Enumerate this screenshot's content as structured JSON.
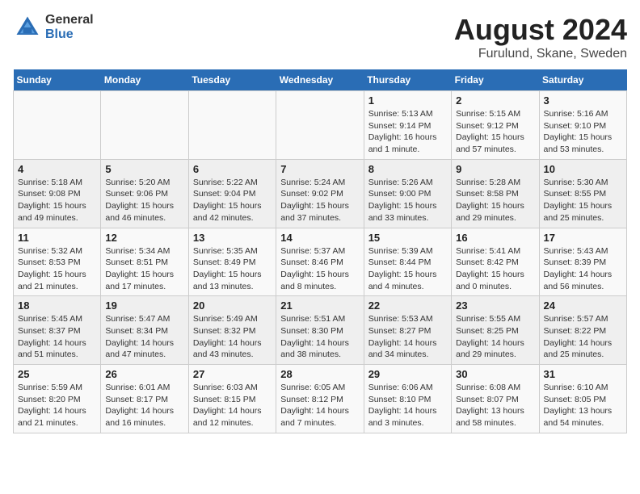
{
  "header": {
    "logo_general": "General",
    "logo_blue": "Blue",
    "main_title": "August 2024",
    "subtitle": "Furulund, Skane, Sweden"
  },
  "calendar": {
    "days_of_week": [
      "Sunday",
      "Monday",
      "Tuesday",
      "Wednesday",
      "Thursday",
      "Friday",
      "Saturday"
    ],
    "weeks": [
      [
        {
          "day": "",
          "info": ""
        },
        {
          "day": "",
          "info": ""
        },
        {
          "day": "",
          "info": ""
        },
        {
          "day": "",
          "info": ""
        },
        {
          "day": "1",
          "info": "Sunrise: 5:13 AM\nSunset: 9:14 PM\nDaylight: 16 hours and 1 minute."
        },
        {
          "day": "2",
          "info": "Sunrise: 5:15 AM\nSunset: 9:12 PM\nDaylight: 15 hours and 57 minutes."
        },
        {
          "day": "3",
          "info": "Sunrise: 5:16 AM\nSunset: 9:10 PM\nDaylight: 15 hours and 53 minutes."
        }
      ],
      [
        {
          "day": "4",
          "info": "Sunrise: 5:18 AM\nSunset: 9:08 PM\nDaylight: 15 hours and 49 minutes."
        },
        {
          "day": "5",
          "info": "Sunrise: 5:20 AM\nSunset: 9:06 PM\nDaylight: 15 hours and 46 minutes."
        },
        {
          "day": "6",
          "info": "Sunrise: 5:22 AM\nSunset: 9:04 PM\nDaylight: 15 hours and 42 minutes."
        },
        {
          "day": "7",
          "info": "Sunrise: 5:24 AM\nSunset: 9:02 PM\nDaylight: 15 hours and 37 minutes."
        },
        {
          "day": "8",
          "info": "Sunrise: 5:26 AM\nSunset: 9:00 PM\nDaylight: 15 hours and 33 minutes."
        },
        {
          "day": "9",
          "info": "Sunrise: 5:28 AM\nSunset: 8:58 PM\nDaylight: 15 hours and 29 minutes."
        },
        {
          "day": "10",
          "info": "Sunrise: 5:30 AM\nSunset: 8:55 PM\nDaylight: 15 hours and 25 minutes."
        }
      ],
      [
        {
          "day": "11",
          "info": "Sunrise: 5:32 AM\nSunset: 8:53 PM\nDaylight: 15 hours and 21 minutes."
        },
        {
          "day": "12",
          "info": "Sunrise: 5:34 AM\nSunset: 8:51 PM\nDaylight: 15 hours and 17 minutes."
        },
        {
          "day": "13",
          "info": "Sunrise: 5:35 AM\nSunset: 8:49 PM\nDaylight: 15 hours and 13 minutes."
        },
        {
          "day": "14",
          "info": "Sunrise: 5:37 AM\nSunset: 8:46 PM\nDaylight: 15 hours and 8 minutes."
        },
        {
          "day": "15",
          "info": "Sunrise: 5:39 AM\nSunset: 8:44 PM\nDaylight: 15 hours and 4 minutes."
        },
        {
          "day": "16",
          "info": "Sunrise: 5:41 AM\nSunset: 8:42 PM\nDaylight: 15 hours and 0 minutes."
        },
        {
          "day": "17",
          "info": "Sunrise: 5:43 AM\nSunset: 8:39 PM\nDaylight: 14 hours and 56 minutes."
        }
      ],
      [
        {
          "day": "18",
          "info": "Sunrise: 5:45 AM\nSunset: 8:37 PM\nDaylight: 14 hours and 51 minutes."
        },
        {
          "day": "19",
          "info": "Sunrise: 5:47 AM\nSunset: 8:34 PM\nDaylight: 14 hours and 47 minutes."
        },
        {
          "day": "20",
          "info": "Sunrise: 5:49 AM\nSunset: 8:32 PM\nDaylight: 14 hours and 43 minutes."
        },
        {
          "day": "21",
          "info": "Sunrise: 5:51 AM\nSunset: 8:30 PM\nDaylight: 14 hours and 38 minutes."
        },
        {
          "day": "22",
          "info": "Sunrise: 5:53 AM\nSunset: 8:27 PM\nDaylight: 14 hours and 34 minutes."
        },
        {
          "day": "23",
          "info": "Sunrise: 5:55 AM\nSunset: 8:25 PM\nDaylight: 14 hours and 29 minutes."
        },
        {
          "day": "24",
          "info": "Sunrise: 5:57 AM\nSunset: 8:22 PM\nDaylight: 14 hours and 25 minutes."
        }
      ],
      [
        {
          "day": "25",
          "info": "Sunrise: 5:59 AM\nSunset: 8:20 PM\nDaylight: 14 hours and 21 minutes."
        },
        {
          "day": "26",
          "info": "Sunrise: 6:01 AM\nSunset: 8:17 PM\nDaylight: 14 hours and 16 minutes."
        },
        {
          "day": "27",
          "info": "Sunrise: 6:03 AM\nSunset: 8:15 PM\nDaylight: 14 hours and 12 minutes."
        },
        {
          "day": "28",
          "info": "Sunrise: 6:05 AM\nSunset: 8:12 PM\nDaylight: 14 hours and 7 minutes."
        },
        {
          "day": "29",
          "info": "Sunrise: 6:06 AM\nSunset: 8:10 PM\nDaylight: 14 hours and 3 minutes."
        },
        {
          "day": "30",
          "info": "Sunrise: 6:08 AM\nSunset: 8:07 PM\nDaylight: 13 hours and 58 minutes."
        },
        {
          "day": "31",
          "info": "Sunrise: 6:10 AM\nSunset: 8:05 PM\nDaylight: 13 hours and 54 minutes."
        }
      ]
    ]
  }
}
